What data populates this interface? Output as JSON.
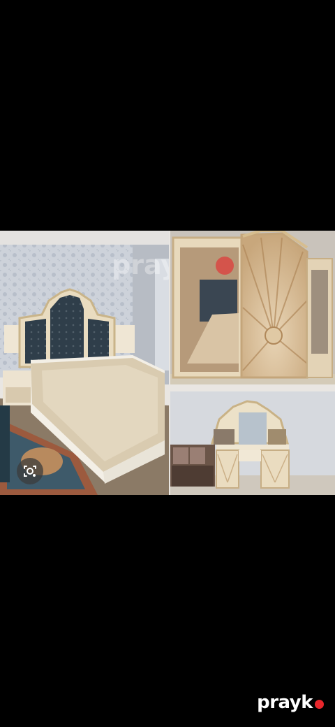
{
  "page": {
    "background": "#000000"
  },
  "watermark": {
    "brand_text": "prayk",
    "dot_color": "#e8262b"
  },
  "lens_button": {
    "icon": "camera-search-icon"
  },
  "brand_logo": {
    "text": "prayk",
    "dot_color": "#e8262b",
    "text_color": "#ffffff"
  }
}
